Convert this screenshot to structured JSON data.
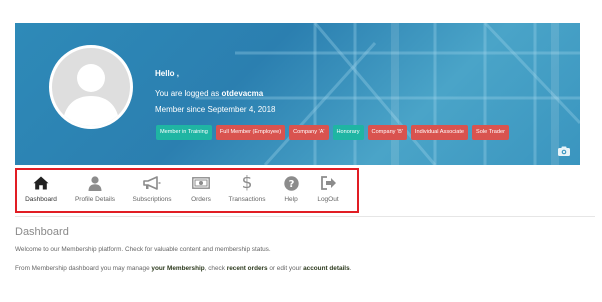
{
  "profile": {
    "greeting": "Hello ,",
    "logged_prefix": "You are logged as",
    "username": "otdevacma",
    "member_since": "Member since September 4, 2018"
  },
  "badges": [
    {
      "label": "Member in Training",
      "color": "#1fb5a3"
    },
    {
      "label": "Full Member (Employee)",
      "color": "#d9534f"
    },
    {
      "label": "Company 'A'",
      "color": "#d9534f"
    },
    {
      "label": "Honorary",
      "color": "#1fb5a3"
    },
    {
      "label": "Company 'B'",
      "color": "#d9534f"
    },
    {
      "label": "Individual Associate",
      "color": "#d9534f"
    },
    {
      "label": "Sole Trader",
      "color": "#d9534f"
    }
  ],
  "nav": {
    "items": [
      {
        "label": "Dashboard",
        "icon": "home-icon"
      },
      {
        "label": "Profile Details",
        "icon": "user-icon"
      },
      {
        "label": "Subscriptions",
        "icon": "megaphone-icon"
      },
      {
        "label": "Orders",
        "icon": "money-icon"
      },
      {
        "label": "Transactions",
        "icon": "dollar-icon"
      },
      {
        "label": "Help",
        "icon": "question-icon"
      },
      {
        "label": "LogOut",
        "icon": "logout-icon"
      }
    ]
  },
  "main": {
    "title": "Dashboard",
    "welcome": "Welcome to our Membership platform. Check for valuable content and membership status.",
    "p2_a": "From Membership dashboard you may manage ",
    "link_membership": "your Membership",
    "p2_b": ", check ",
    "link_orders": "recent orders",
    "p2_c": " or edit your ",
    "link_account": "account details",
    "p2_d": "."
  },
  "colors": {
    "accent_red": "#e11d24",
    "teal": "#1fb5a3",
    "badge_red": "#d9534f",
    "banner_blue": "#2e8ab8"
  }
}
